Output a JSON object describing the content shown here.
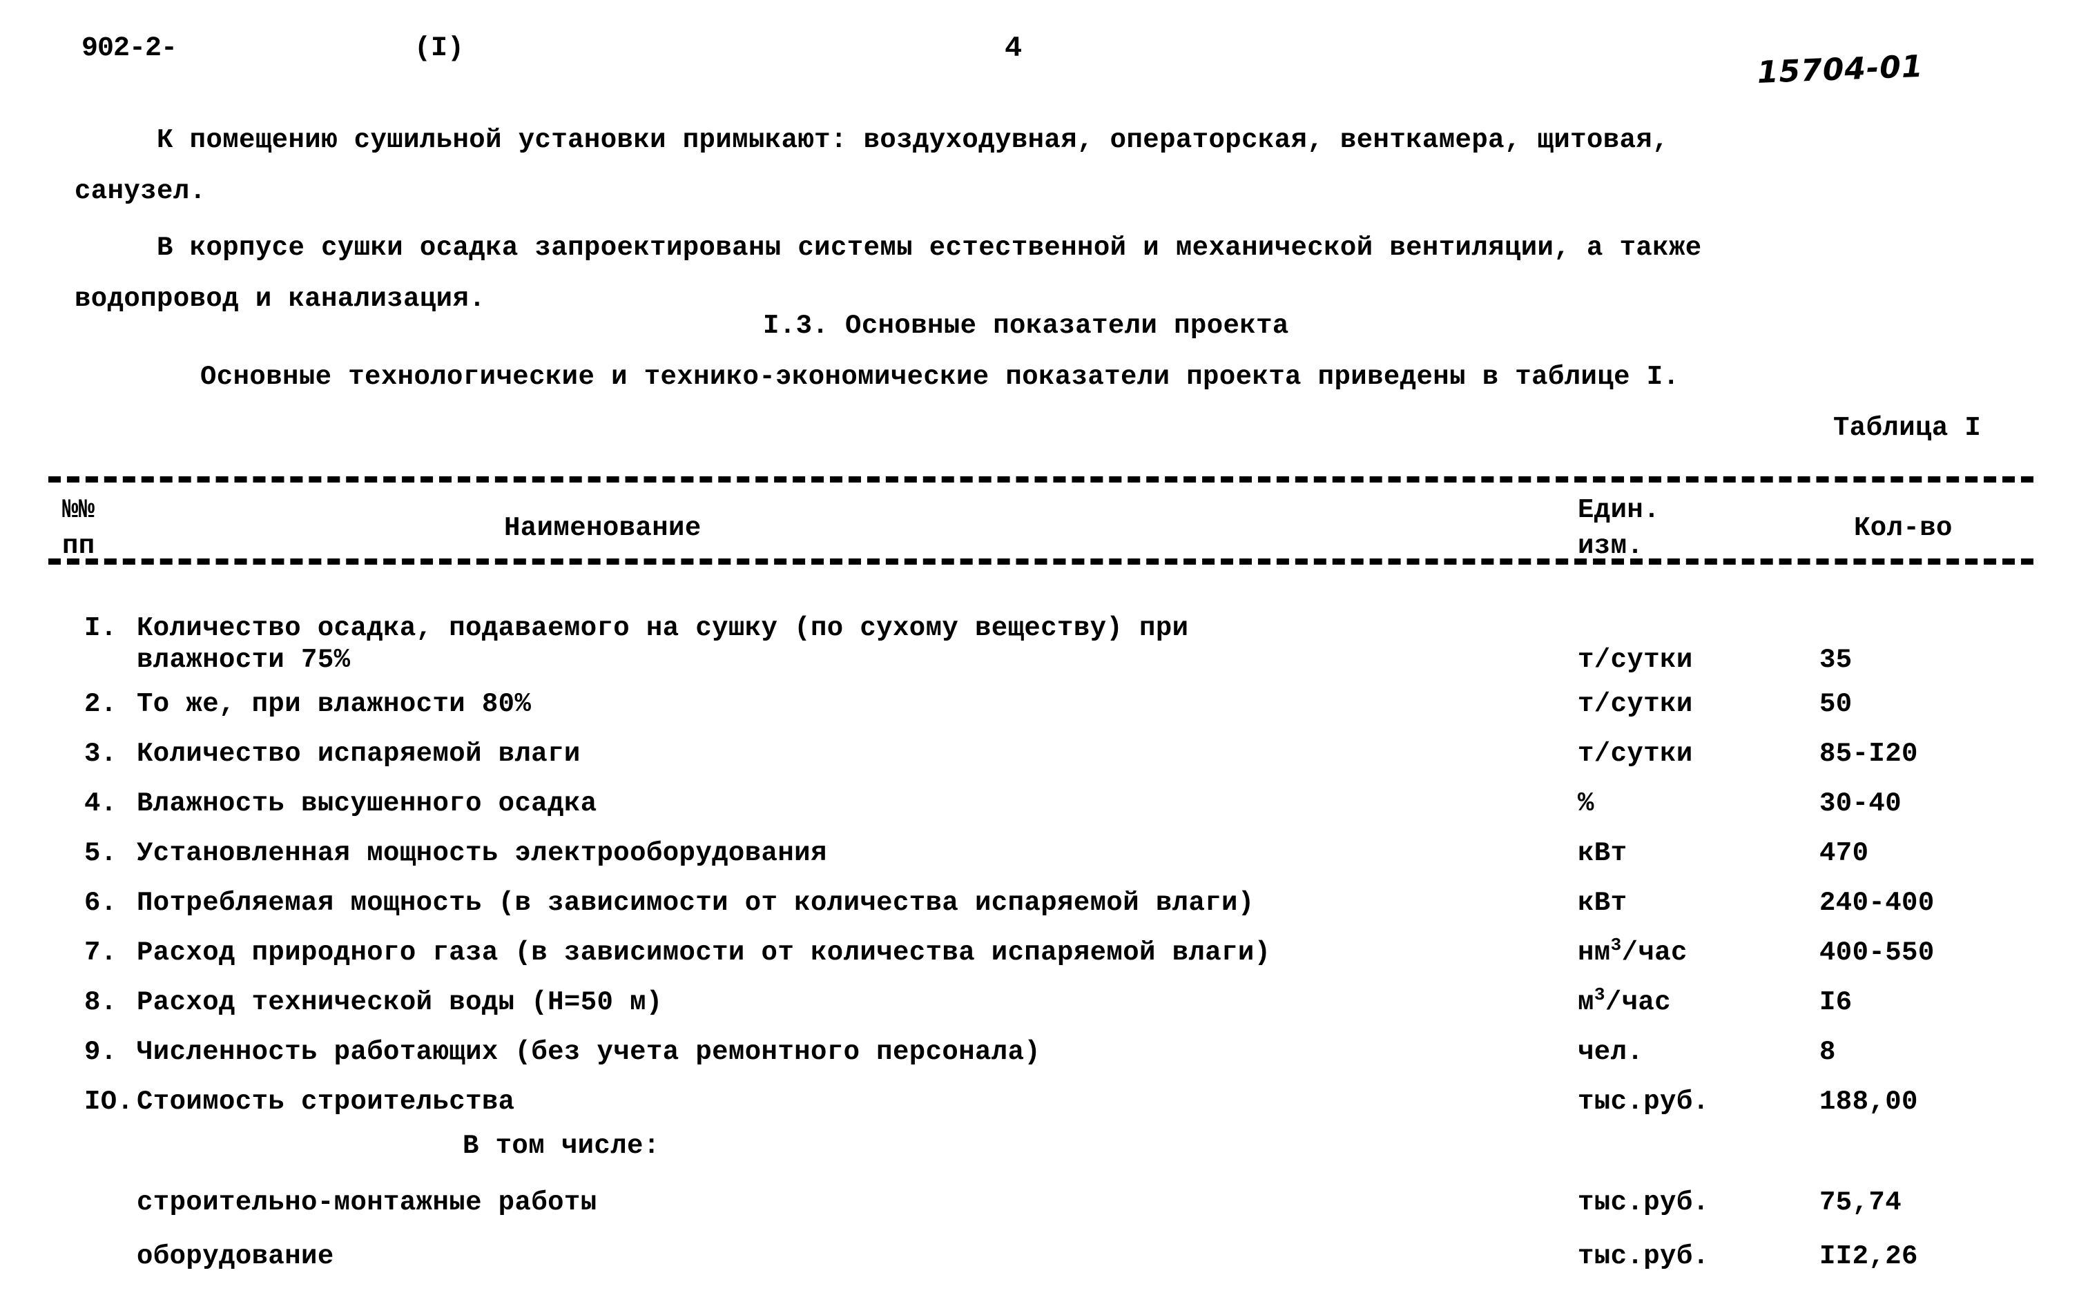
{
  "header": {
    "doc_code": "902-2-",
    "part": "(I)",
    "page_number": "4",
    "handwritten_note": "15704-01"
  },
  "paragraphs": [
    "     К помещению сушильной установки примыкают: воздуходувная, операторская, венткамера, щитовая,\nсанузел.",
    "     В корпусе сушки осадка запроектированы системы естественной и механической вентиляции, а также\nводопровод и канализация."
  ],
  "section": {
    "heading": "I.3.  Основные показатели проекта",
    "intro": "Основные технологические и технико-экономические показатели проекта приведены в таблице I.",
    "table_caption": "Таблица I"
  },
  "table": {
    "columns": {
      "no": "№№\nпп",
      "name": "Наименование",
      "unit": "Един.\nизм.",
      "qty": "Кол-во"
    },
    "rows": [
      {
        "no": "I.",
        "name": "Количество осадка, подаваемого на сушку (по сухому веществу) при",
        "name_line2": "влажности 75%",
        "unit": "т/сутки",
        "qty": "35"
      },
      {
        "no": "2.",
        "name": "То же, при влажности 80%",
        "unit": "т/сутки",
        "qty": "50"
      },
      {
        "no": "3.",
        "name": "Количество испаряемой влаги",
        "unit": "т/сутки",
        "qty": "85-I20"
      },
      {
        "no": "4.",
        "name": "Влажность высушенного осадка",
        "unit": "%",
        "qty": "30-40"
      },
      {
        "no": "5.",
        "name": "Установленная мощность электрооборудования",
        "unit": "кВт",
        "qty": "470"
      },
      {
        "no": "6.",
        "name": "Потребляемая мощность (в зависимости от количества испаряемой влаги)",
        "unit": "кВт",
        "qty": "240-400"
      },
      {
        "no": "7.",
        "name": "Расход природного газа (в зависимости от количества испаряемой влаги)",
        "unit_base": "нм",
        "unit_sup": "3",
        "unit_rest": "/час",
        "qty": "400-550"
      },
      {
        "no": "8.",
        "name": "Расход технической воды (H=50 м)",
        "unit_base": "м",
        "unit_sup": "3",
        "unit_rest": "/час",
        "qty": "I6"
      },
      {
        "no": "9.",
        "name": "Численность работающих (без учета ремонтного персонала)",
        "unit": "чел.",
        "qty": "8"
      },
      {
        "no": "IO.",
        "name": "Стоимость строительства",
        "unit": "тыс.руб.",
        "qty": "188,00"
      }
    ],
    "subtotal_heading": "В том числе:",
    "subtotal_rows": [
      {
        "name": "строительно-монтажные работы",
        "unit": "тыс.руб.",
        "qty": "75,74"
      },
      {
        "name": "оборудование",
        "unit": "тыс.руб.",
        "qty": "II2,26"
      }
    ]
  }
}
